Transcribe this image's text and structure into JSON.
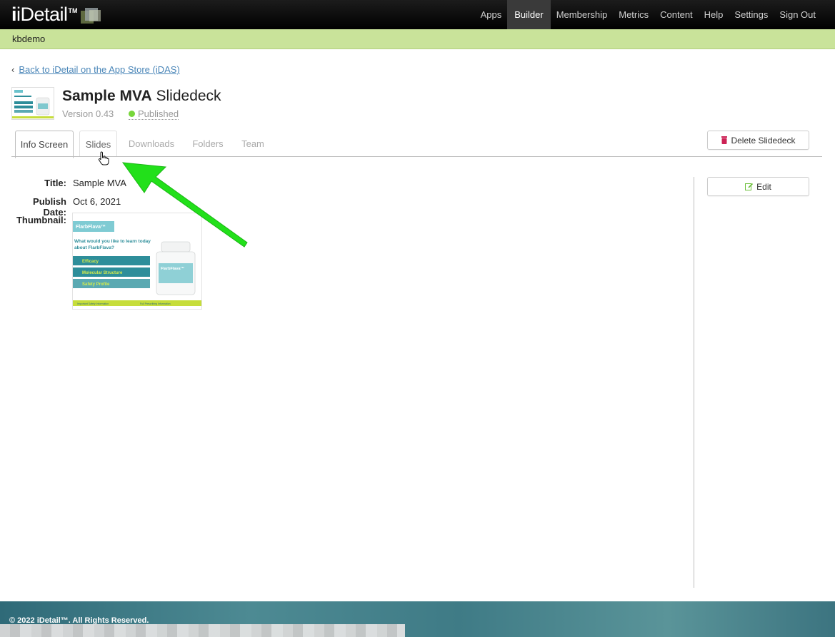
{
  "brand": {
    "logo_text": "iDetail",
    "logo_tm": "TM"
  },
  "nav": {
    "items": [
      {
        "label": "Apps",
        "active": false
      },
      {
        "label": "Builder",
        "active": true
      },
      {
        "label": "Membership",
        "active": false
      },
      {
        "label": "Metrics",
        "active": false
      },
      {
        "label": "Content",
        "active": false
      },
      {
        "label": "Help",
        "active": false
      },
      {
        "label": "Settings",
        "active": false
      },
      {
        "label": "Sign Out",
        "active": false
      }
    ]
  },
  "account": {
    "name": "kbdemo"
  },
  "back_link": {
    "label": "Back to iDetail on the App Store (iDAS)"
  },
  "deck": {
    "name_bold": "Sample MVA",
    "name_type": "Slidedeck",
    "version": "Version 0.43",
    "status": "Published"
  },
  "tabs": [
    {
      "label": "Info Screen"
    },
    {
      "label": "Slides"
    },
    {
      "label": "Downloads"
    },
    {
      "label": "Folders"
    },
    {
      "label": "Team"
    }
  ],
  "buttons": {
    "delete": "Delete Slidedeck",
    "edit": "Edit"
  },
  "info": {
    "title_label": "Title:",
    "title_value": "Sample MVA",
    "publish_label": "Publish Date:",
    "publish_value": "Oct 6, 2021",
    "thumbnail_label": "Thumbnail:"
  },
  "thumbnail": {
    "brand": "FlarbFlava™",
    "heading": "What would you like to learn today about FlarbFlava?",
    "menu": [
      "Efficacy",
      "Molecular Structure",
      "Safety Profile"
    ],
    "bottle_brand": "FlarbFlava™",
    "footer_left": "Important Safety Information",
    "footer_right": "Full Prescribing Information"
  },
  "footer": {
    "copyright": "© 2022 iDetail™.  All Rights Reserved."
  },
  "colors": {
    "accent_green": "#c9e39a",
    "arrow_green": "#22e01a",
    "status_dot": "#77d63a",
    "delete_icon": "#cc2255"
  }
}
